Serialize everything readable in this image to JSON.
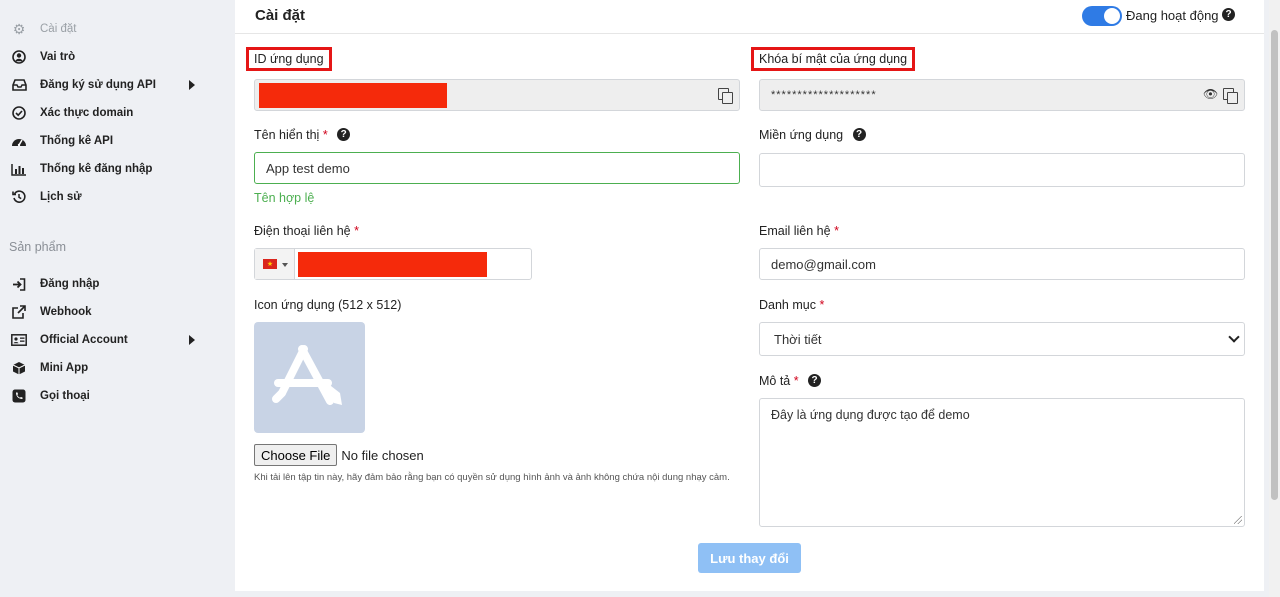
{
  "sidebar": {
    "items": [
      {
        "label": "Cài đặt",
        "icon": "gear-icon"
      },
      {
        "label": "Vai trò",
        "icon": "user-circle-icon"
      },
      {
        "label": "Đăng ký sử dụng API",
        "icon": "inbox-icon"
      },
      {
        "label": "Xác thực domain",
        "icon": "check-circle-icon"
      },
      {
        "label": "Thống kê API",
        "icon": "gauge-icon"
      },
      {
        "label": "Thống kê đăng nhập",
        "icon": "bar-chart-icon"
      },
      {
        "label": "Lịch sử",
        "icon": "history-icon"
      }
    ],
    "section_title": "Sản phẩm",
    "product_items": [
      {
        "label": "Đăng nhập",
        "icon": "sign-in-icon"
      },
      {
        "label": "Webhook",
        "icon": "external-link-icon"
      },
      {
        "label": "Official Account",
        "icon": "id-card-icon"
      },
      {
        "label": "Mini App",
        "icon": "cube-icon"
      },
      {
        "label": "Gọi thoại",
        "icon": "phone-icon"
      }
    ]
  },
  "header": {
    "title": "Cài đặt",
    "status_label": "Đang hoạt động",
    "status_active": true
  },
  "form": {
    "app_id": {
      "label": "ID ứng dụng"
    },
    "app_secret": {
      "label": "Khóa bí mật của ứng dụng",
      "value": "********************"
    },
    "display_name": {
      "label": "Tên hiển thị",
      "required_mark": "*",
      "value": "App test demo",
      "validation": "Tên hợp lệ"
    },
    "app_domain": {
      "label": "Miền ứng dụng",
      "value": ""
    },
    "phone": {
      "label": "Điện thoại liên hệ",
      "required_mark": "*",
      "flag": "★"
    },
    "email": {
      "label": "Email liên hệ",
      "required_mark": "*",
      "value": "demo@gmail.com"
    },
    "icon": {
      "label": "Icon ứng dụng (512 x 512)",
      "choose_label": "Choose File",
      "file_status": "No file chosen",
      "hint": "Khi tải lên tập tin này, hãy đảm bảo rằng bạn có quyền sử dụng hình ảnh và ảnh không chứa nội dung nhạy cảm."
    },
    "category": {
      "label": "Danh mục",
      "required_mark": "*",
      "value": "Thời tiết"
    },
    "description": {
      "label": "Mô tả",
      "required_mark": "*",
      "value": "Đây là ứng dụng được tạo để demo"
    },
    "help_glyph": "?",
    "eye_glyph": "👁",
    "save_label": "Lưu thay đổi"
  },
  "colors": {
    "accent": "#2f7be5",
    "valid": "#4caf50",
    "highlight": "#e51616",
    "redaction": "#f52a0b",
    "save_button": "#8fc0f5"
  }
}
